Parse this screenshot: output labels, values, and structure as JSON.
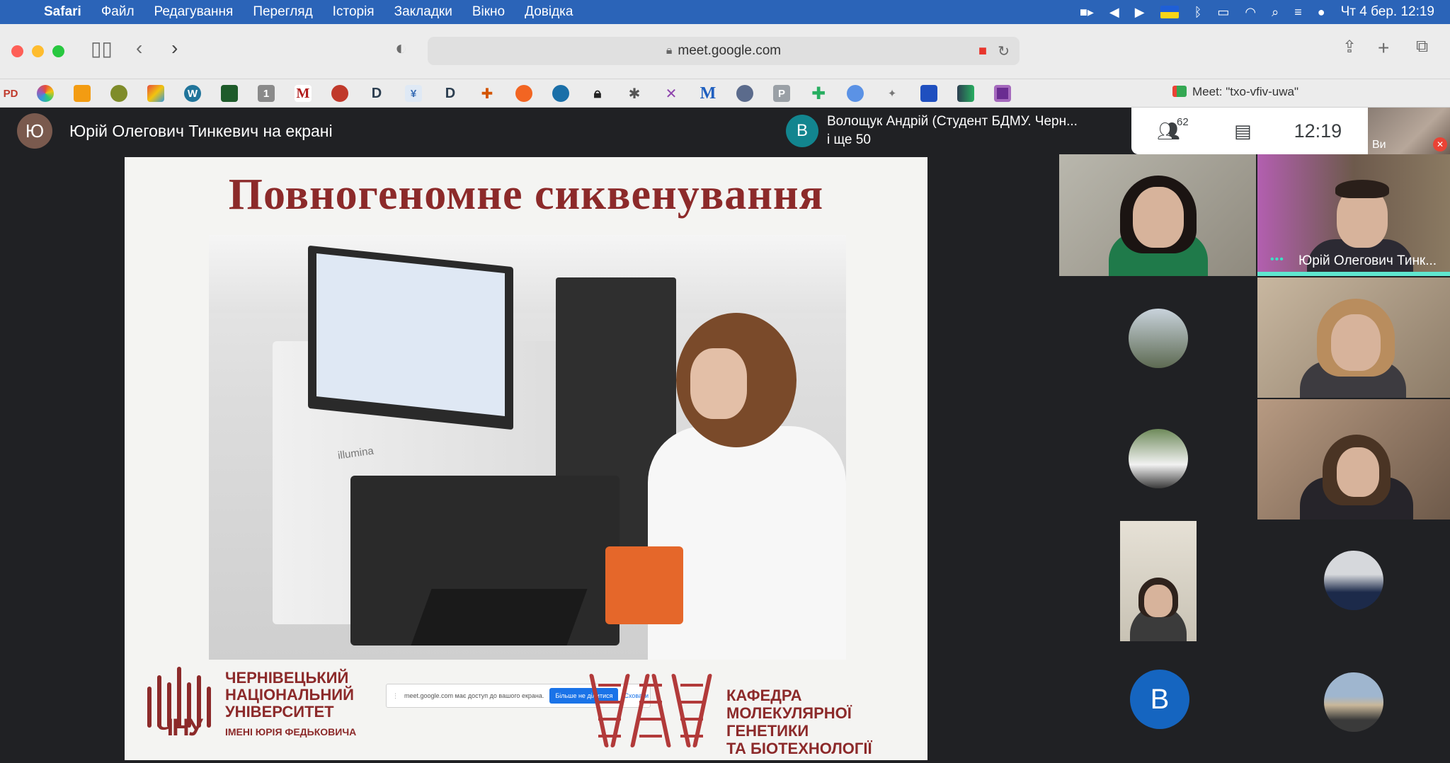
{
  "menubar": {
    "app": "Safari",
    "items": [
      "Файл",
      "Редагування",
      "Перегляд",
      "Історія",
      "Закладки",
      "Вікно",
      "Довідка"
    ],
    "datetime": "Чт 4 бер.  12:19"
  },
  "browser": {
    "url": "meet.google.com",
    "tab_title": "Meet: \"txo-vfiv-uwa\"",
    "bookmark_labels": [
      "PD",
      "1",
      "M",
      "D",
      "D",
      "M",
      "P"
    ]
  },
  "meet": {
    "presenter_initial": "Ю",
    "presenter_text": "Юрій Олегович Тинкевич на екрані",
    "notification_initial": "В",
    "notification_line1": "Волощук Андрій (Студент БДМУ. Черн...",
    "notification_line2": "і ще 50",
    "participant_count": "62",
    "clock": "12:19",
    "self_label": "Ви",
    "speaker_name": "Юрій Олегович Тинк...",
    "letter_participant": "В"
  },
  "slide": {
    "title": "Повногеномне сиквенування",
    "photo_brand": "illumina",
    "logo_word": "ЧНУ",
    "university_lines": [
      "ЧЕРНІВЕЦЬКИЙ",
      "НАЦІОНАЛЬНИЙ",
      "УНІВЕРСИТЕТ"
    ],
    "university_sub": "ІМЕНІ ЮРІЯ ФЕДЬКОВИЧА",
    "department_lines": [
      "КАФЕДРА",
      "МОЛЕКУЛЯРНОЇ ГЕНЕТИКИ",
      "ТА БІОТЕХНОЛОГІЇ"
    ]
  },
  "share_popup": {
    "message": "meet.google.com має доступ до вашого екрана.",
    "stop_label": "Більше не ділитися",
    "hide_label": "Сховати"
  },
  "colors": {
    "menubar": "#2b64b8",
    "slide_accent": "#8c2a2a",
    "meet_bg": "#202124",
    "speaking": "#5fe6cf"
  }
}
